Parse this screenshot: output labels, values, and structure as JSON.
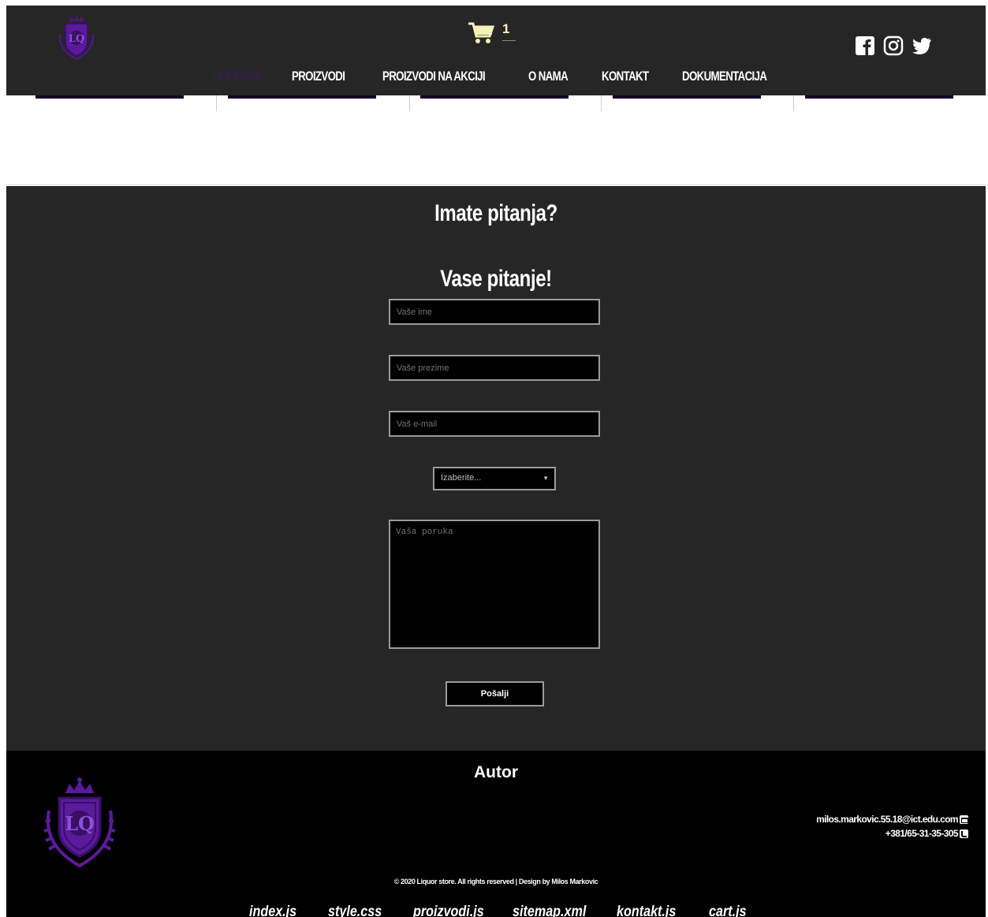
{
  "header": {
    "cart_count": "1",
    "nav": [
      {
        "label": "POCETNA",
        "active": true
      },
      {
        "label": "PROIZVODI",
        "active": false
      },
      {
        "label": "PROIZVODI NA AKCIJI",
        "active": false
      },
      {
        "label": "O NAMA",
        "active": false
      },
      {
        "label": "KONTAKT",
        "active": false
      },
      {
        "label": "DOKUMENTACIJA",
        "active": false
      }
    ],
    "socials": [
      "facebook-icon",
      "instagram-icon",
      "twitter-icon"
    ]
  },
  "contact": {
    "title": "Imate pitanja?",
    "subtitle": "Vase pitanje!",
    "first_name_placeholder": "Vaše ime",
    "last_name_placeholder": "Vaše prezime",
    "email_placeholder": "Vaš e-mail",
    "select_value": "Izaberite...",
    "message_placeholder": "Vaša poruka",
    "submit_label": "Pošalji"
  },
  "footer": {
    "heading": "Autor",
    "email": "milos.markovic.55.18@ict.edu.com",
    "phone": "+381/65-31-35-305",
    "copyright": "© 2020 Liquor store. All rights reserved | Design by Milos Markovic",
    "doc_links": [
      "index.js",
      "style.css",
      "proizvodi.js",
      "sitemap.xml",
      "kontakt.js",
      "cart.js"
    ]
  },
  "colors": {
    "brand_purple": "#5b1a9c",
    "dark_bg": "#262626",
    "cart_yellow": "#f5f0b5"
  }
}
